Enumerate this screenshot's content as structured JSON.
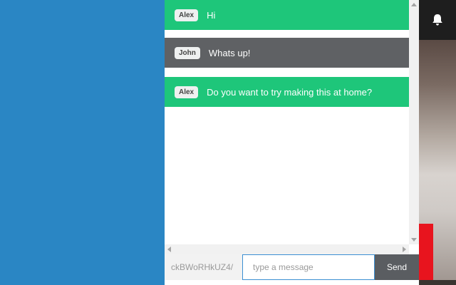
{
  "messages": [
    {
      "author": "Alex",
      "text": "Hi",
      "style": "green"
    },
    {
      "author": "John",
      "text": "Whats up!",
      "style": "gray"
    },
    {
      "author": "Alex",
      "text": "Do you want to try making this at home?",
      "style": "green"
    }
  ],
  "composer": {
    "room_id": "ckBWoRHkUZ4/",
    "placeholder": "type a message",
    "value": "",
    "send_label": "Send"
  },
  "icons": {
    "notifications": "bell-icon"
  },
  "colors": {
    "left_panel": "#2a86c4",
    "message_green": "#1ec67a",
    "message_gray": "#5f6164",
    "send_button": "#5a5d61",
    "input_border": "#3b8fd3",
    "bell_box": "#1e1e1e"
  }
}
